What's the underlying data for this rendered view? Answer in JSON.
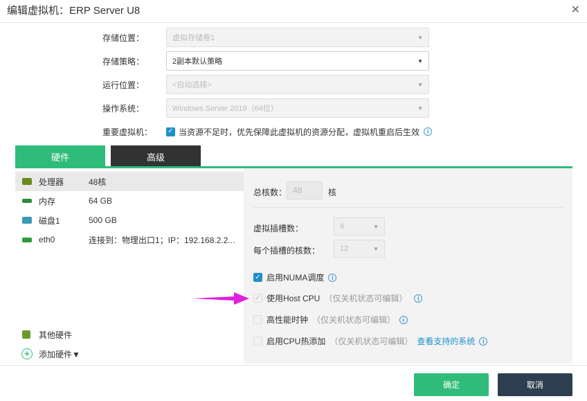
{
  "dialog": {
    "title": "编辑虚拟机：ERP Server U8"
  },
  "form": {
    "storage_location": {
      "label": "存储位置：",
      "value": "虚拟存储卷1"
    },
    "storage_policy": {
      "label": "存储策略：",
      "value": "2副本默认策略"
    },
    "run_location": {
      "label": "运行位置：",
      "value": "<自动选择>"
    },
    "os": {
      "label": "操作系统：",
      "value": "Windows Server 2019（64位）"
    },
    "important_vm": {
      "label": "重要虚拟机：",
      "checkbox_text": "当资源不足时，优先保障此虚拟机的资源分配，虚拟机重启后生效",
      "checked": true
    }
  },
  "tabs": {
    "hardware": "硬件",
    "advanced": "高级"
  },
  "hardware": {
    "items": [
      {
        "name": "处理器",
        "value": "48核",
        "icon": "cpu-icon",
        "color": "#6a8a1e"
      },
      {
        "name": "内存",
        "value": "64 GB",
        "icon": "memory-icon",
        "color": "#2e8b3e"
      },
      {
        "name": "磁盘1",
        "value": "500 GB",
        "icon": "disk-icon",
        "color": "#3a9ab5"
      },
      {
        "name": "eth0",
        "value": "连接到：物理出口1；IP：192.168.2.2...",
        "icon": "network-icon",
        "color": "#2e9a3e"
      }
    ],
    "other": "其他硬件",
    "add": "添加硬件▼"
  },
  "cpu": {
    "total_cores_label": "总核数：",
    "total_cores_value": "48",
    "total_cores_unit": "核",
    "sockets_label": "虚拟插槽数：",
    "sockets_value": "4",
    "cores_per_socket_label": "每个插槽的核数：",
    "cores_per_socket_value": "12",
    "numa": {
      "label": "启用NUMA调度",
      "checked": true
    },
    "host_cpu": {
      "label": "使用Host CPU",
      "hint": "（仅关机状态可编辑）",
      "checked": true,
      "disabled": true
    },
    "hp_clock": {
      "label": "高性能时钟",
      "hint": "（仅关机状态可编辑）"
    },
    "cpu_hotplug": {
      "label": "启用CPU热添加",
      "hint": "（仅关机状态可编辑）",
      "link": "查看支持的系统"
    }
  },
  "buttons": {
    "ok": "确定",
    "cancel": "取消"
  },
  "colors": {
    "accent": "#2fbc7a",
    "dark_tab": "#323232",
    "arrow": "#e020e0",
    "cancel": "#2d3e50"
  }
}
